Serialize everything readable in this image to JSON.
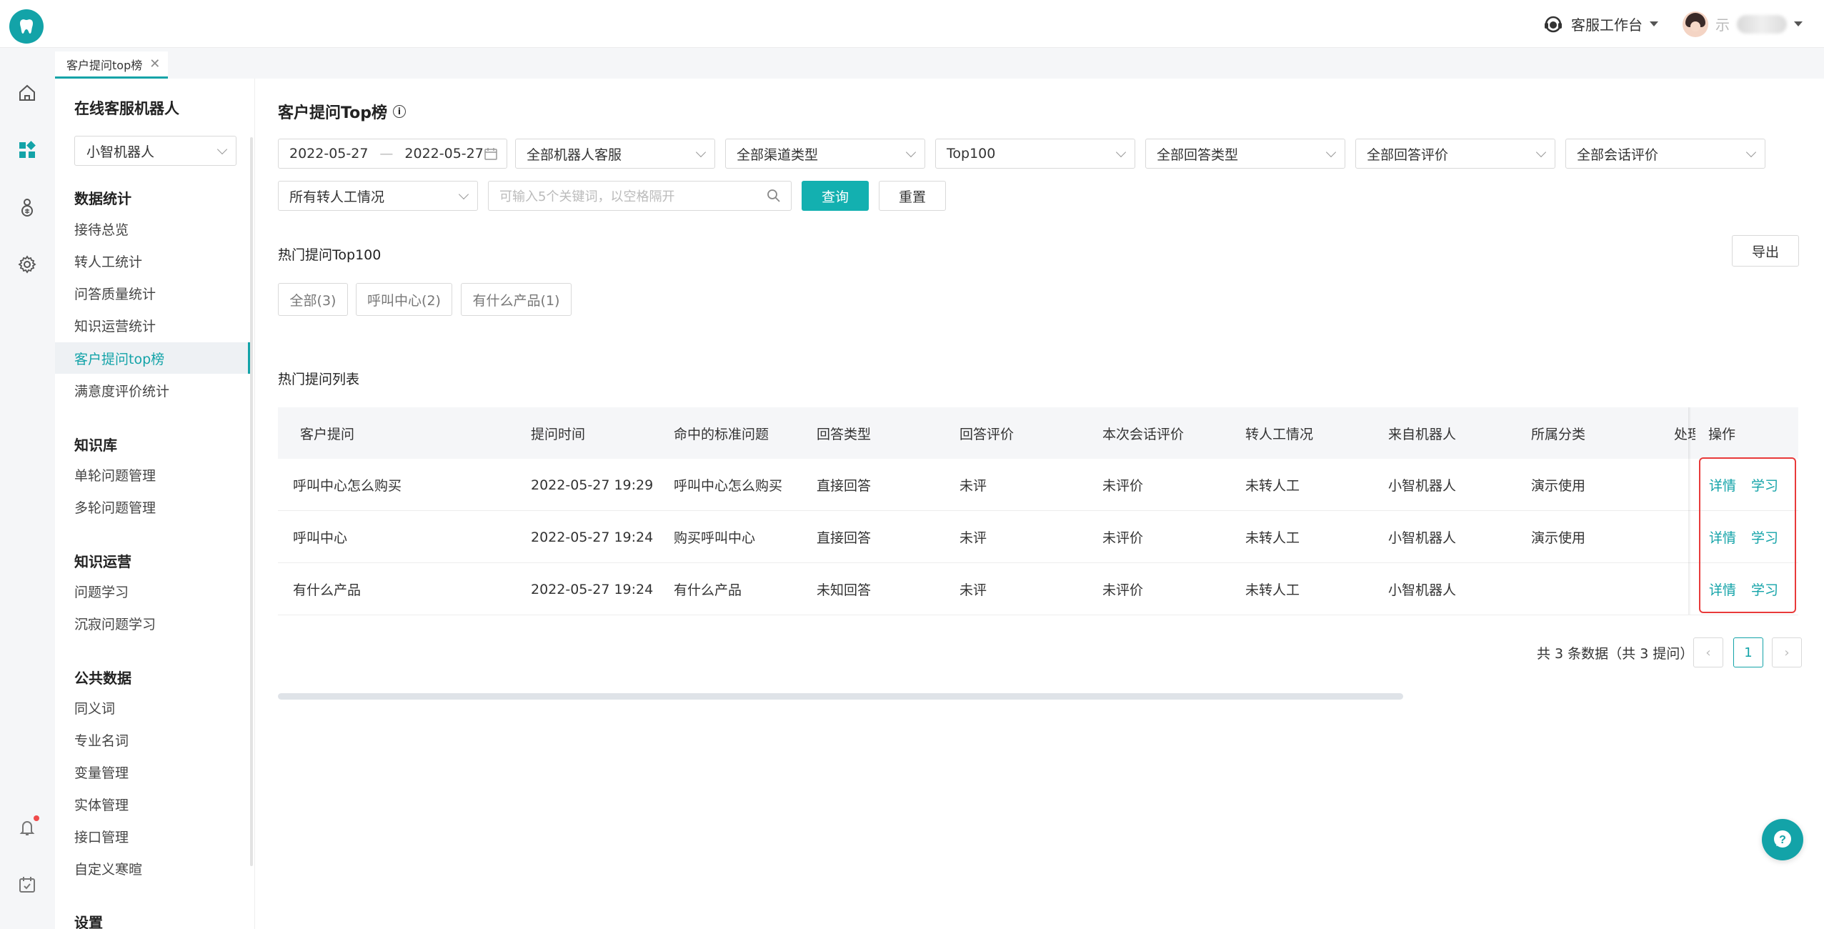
{
  "header": {
    "workbench_label": "客服工作台",
    "user_initial": "示"
  },
  "tab": {
    "label": "客户提问top榜",
    "close": "✕"
  },
  "subnav": {
    "title": "在线客服机器人",
    "bot_select": "小智机器人",
    "groups": [
      {
        "label": "数据统计",
        "items": [
          "接待总览",
          "转人工统计",
          "问答质量统计",
          "知识运营统计",
          "客户提问top榜",
          "满意度评价统计"
        ]
      },
      {
        "label": "知识库",
        "items": [
          "单轮问题管理",
          "多轮问题管理"
        ]
      },
      {
        "label": "知识运营",
        "items": [
          "问题学习",
          "沉寂问题学习"
        ]
      },
      {
        "label": "公共数据",
        "items": [
          "同义词",
          "专业名词",
          "变量管理",
          "实体管理",
          "接口管理",
          "自定义寒暄"
        ]
      },
      {
        "label": "设置",
        "items": []
      }
    ],
    "active_item": "客户提问top榜"
  },
  "main": {
    "title": "客户提问Top榜",
    "info": "i",
    "filters": {
      "date_start": "2022-05-27",
      "date_sep": "—",
      "date_end": "2022-05-27",
      "robot": "全部机器人客服",
      "channel": "全部渠道类型",
      "top": "Top100",
      "answer_type": "全部回答类型",
      "answer_rating": "全部回答评价",
      "session_rating": "全部会话评价",
      "transfer": "所有转人工情况",
      "keyword_placeholder": "可输入5个关键词，以空格隔开",
      "query_button": "查询",
      "reset_button": "重置"
    },
    "hot_section_title": "热门提问Top100",
    "export_button": "导出",
    "chips": [
      "全部(3)",
      "呼叫中心(2)",
      "有什么产品(1)"
    ],
    "list_title": "热门提问列表",
    "columns": [
      "客户提问",
      "提问时间",
      "命中的标准问题",
      "回答类型",
      "回答评价",
      "本次会话评价",
      "转人工情况",
      "来自机器人",
      "所属分类",
      "处理",
      "操作"
    ],
    "rows": [
      [
        "呼叫中心怎么购买",
        "2022-05-27 19:29",
        "呼叫中心怎么购买",
        "直接回答",
        "未评",
        "未评价",
        "未转人工",
        "小智机器人",
        "演示使用"
      ],
      [
        "呼叫中心",
        "2022-05-27 19:24",
        "购买呼叫中心",
        "直接回答",
        "未评",
        "未评价",
        "未转人工",
        "小智机器人",
        "演示使用"
      ],
      [
        "有什么产品",
        "2022-05-27 19:24",
        "有什么产品",
        "未知回答",
        "未评",
        "未评价",
        "未转人工",
        "小智机器人",
        ""
      ]
    ],
    "row_actions": {
      "detail": "详情",
      "learn": "学习"
    },
    "pagination": {
      "summary": "共 3 条数据（共 3 提问）",
      "current_page": "1",
      "prev": "‹",
      "next": "›"
    }
  },
  "colors": {
    "accent": "#13a3a8",
    "highlight_box": "#e83a3a"
  }
}
